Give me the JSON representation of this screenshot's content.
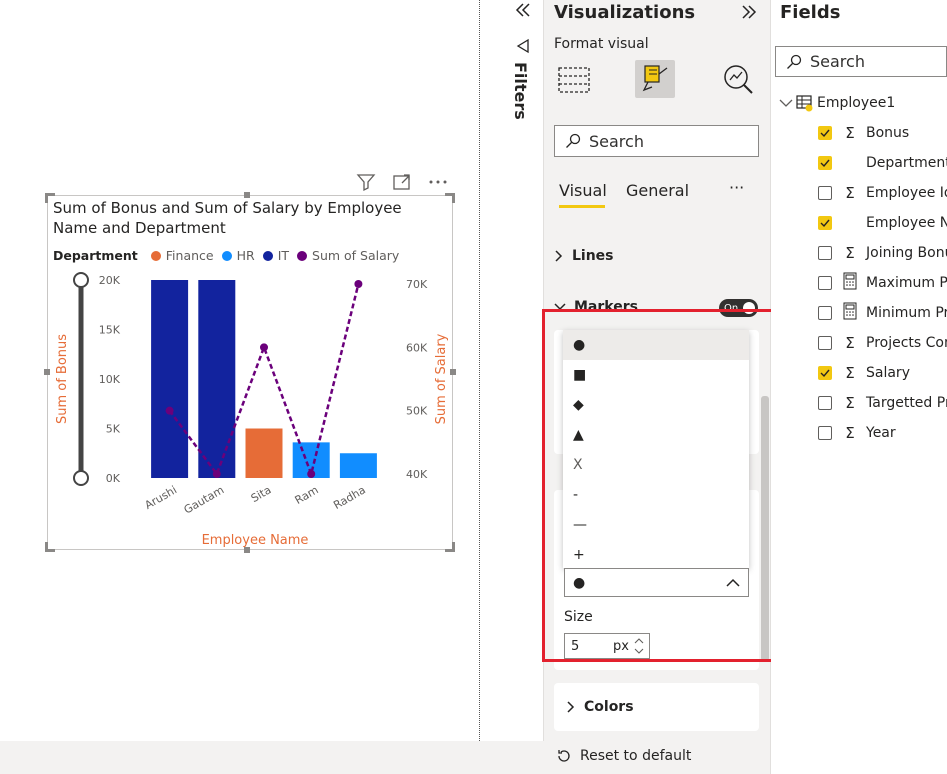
{
  "visual": {
    "title": "Sum of Bonus and Sum of Salary by Employee Name and Department",
    "legend_title": "Department",
    "legend_items": [
      {
        "label": "Finance",
        "color": "#e66c37"
      },
      {
        "label": "HR",
        "color": "#118dff"
      },
      {
        "label": "IT",
        "color": "#12239e"
      },
      {
        "label": "Sum of Salary",
        "color": "#6b007b"
      }
    ]
  },
  "chart_data": {
    "type": "bar",
    "categories": [
      "Arushi",
      "Gautam",
      "Sita",
      "Ram",
      "Radha"
    ],
    "series": [
      {
        "name": "Sum of Bonus",
        "values": [
          20000,
          20000,
          5000,
          3600,
          2500
        ],
        "colors": [
          "#12239e",
          "#12239e",
          "#e66c37",
          "#118dff",
          "#118dff"
        ],
        "departments": [
          "IT",
          "IT",
          "Finance",
          "HR",
          "HR"
        ]
      },
      {
        "name": "Sum of Salary",
        "values": [
          50000,
          40000,
          60000,
          40000,
          70000
        ],
        "color": "#6b007b",
        "type": "line",
        "style": "dashed"
      }
    ],
    "xlabel": "Employee Name",
    "ylabel": "Sum of Bonus",
    "y2label": "Sum of Salary",
    "ylim": [
      0,
      20000
    ],
    "y2lim": [
      40000,
      70000
    ],
    "yticks": [
      "20K",
      "15K",
      "10K",
      "5K",
      "0K"
    ],
    "y2ticks": [
      "70K",
      "60K",
      "50K",
      "40K"
    ],
    "axis_title_color": "#e66c37"
  },
  "filters": {
    "label": "Filters"
  },
  "viz_pane": {
    "title": "Visualizations",
    "subtitle": "Format visual",
    "search_placeholder": "Search",
    "tabs": [
      "Visual",
      "General"
    ],
    "more": "···",
    "lines_label": "Lines",
    "markers_label": "Markers",
    "toggle_label": "On",
    "shape_options": [
      "●",
      "■",
      "◆",
      "▲",
      "X",
      "-",
      "—",
      "+"
    ],
    "selected_shape": "●",
    "size_label": "Size",
    "size_value": "5",
    "size_unit": "px",
    "colors_label": "Colors",
    "reset_label": "Reset to default"
  },
  "fields_pane": {
    "title": "Fields",
    "search_placeholder": "Search",
    "table_name": "Employee1",
    "fields": [
      {
        "label": "Bonus",
        "checked": true,
        "sigma": true
      },
      {
        "label": "Department",
        "checked": true,
        "sigma": false
      },
      {
        "label": "Employee Id",
        "checked": false,
        "sigma": true
      },
      {
        "label": "Employee Name",
        "checked": true,
        "sigma": false
      },
      {
        "label": "Joining Bonus",
        "checked": false,
        "sigma": true
      },
      {
        "label": "Maximum Pr",
        "checked": false,
        "calc": true
      },
      {
        "label": "Minimum Pr",
        "checked": false,
        "calc": true
      },
      {
        "label": "Projects Com",
        "checked": false,
        "sigma": true
      },
      {
        "label": "Salary",
        "checked": true,
        "sigma": true
      },
      {
        "label": "Targetted Pr",
        "checked": false,
        "sigma": true
      },
      {
        "label": "Year",
        "checked": false,
        "sigma": true
      }
    ]
  }
}
